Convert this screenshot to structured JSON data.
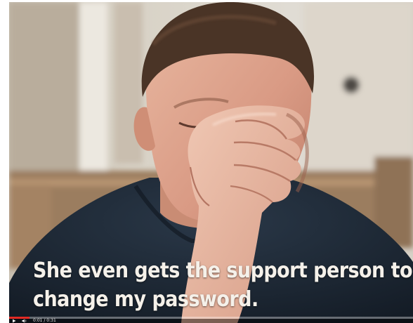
{
  "video": {
    "caption_lines": [
      "She even gets the support person to",
      "change my password."
    ],
    "time_display": "0:01 / 0:31",
    "progress_fraction": 0.05,
    "colors": {
      "progress": "#e32a24",
      "caption_text": "#f5f1ea"
    },
    "icons": [
      "play-icon",
      "volume-icon"
    ]
  }
}
